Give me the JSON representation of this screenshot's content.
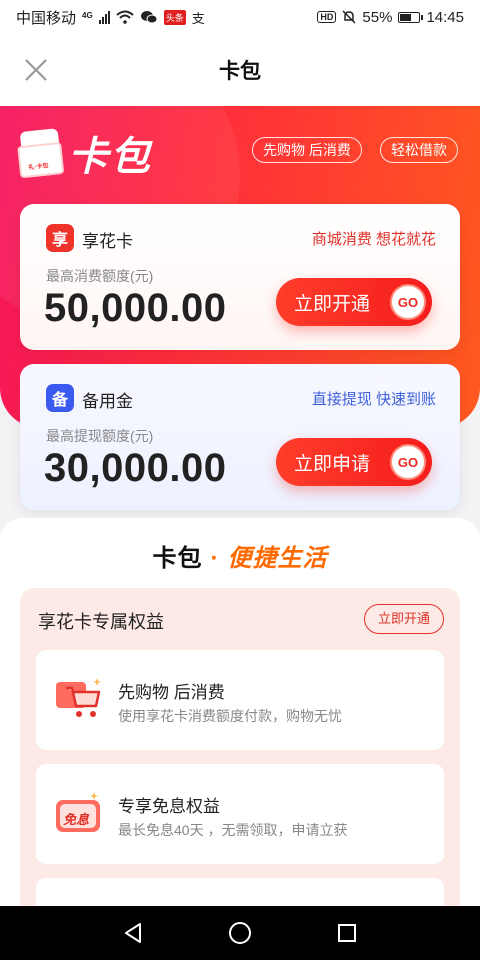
{
  "status_bar": {
    "carrier": "中国移动",
    "network": "4G",
    "news_badge": "头条",
    "extra_icon": "支",
    "hd": "HD",
    "battery": "55%",
    "time": "14:45"
  },
  "header": {
    "title": "卡包",
    "close_icon": "close-icon"
  },
  "banner": {
    "logo_text": "卡包",
    "wallet_label": "礼·卡包",
    "tags": [
      "先购物 后消费",
      "轻松借款"
    ]
  },
  "cards": [
    {
      "icon_char": "享",
      "name": "享花卡",
      "slogan": "商城消费 想花就花",
      "limit_label": "最高消费额度(元)",
      "amount": "50,000.00",
      "button_label": "立即开通",
      "go": "GO"
    },
    {
      "icon_char": "备",
      "name": "备用金",
      "slogan": "直接提现 快速到账",
      "limit_label": "最高提现额度(元)",
      "amount": "30,000.00",
      "button_label": "立即申请",
      "go": "GO"
    }
  ],
  "section": {
    "title_left": "卡包",
    "title_sep": "·",
    "title_right": "便捷生活",
    "benefits_title": "享花卡专属权益",
    "open_button": "立即开通",
    "items": [
      {
        "title": "先购物 后消费",
        "desc": "使用享花卡消费额度付款，购物无忧",
        "icon": "shopping-cart-icon"
      },
      {
        "title": "专享免息权益",
        "desc": "最长免息40天 ，无需领取，申请立获",
        "icon": "interest-free-icon",
        "icon_text": "免息"
      }
    ]
  },
  "navbar": {
    "back": "back-triangle-icon",
    "home": "home-circle-icon",
    "recents": "recents-square-icon"
  },
  "colors": {
    "brand_red": "#f0332a",
    "brand_orange": "#ff6a00",
    "blue_accent": "#3f62d8"
  }
}
